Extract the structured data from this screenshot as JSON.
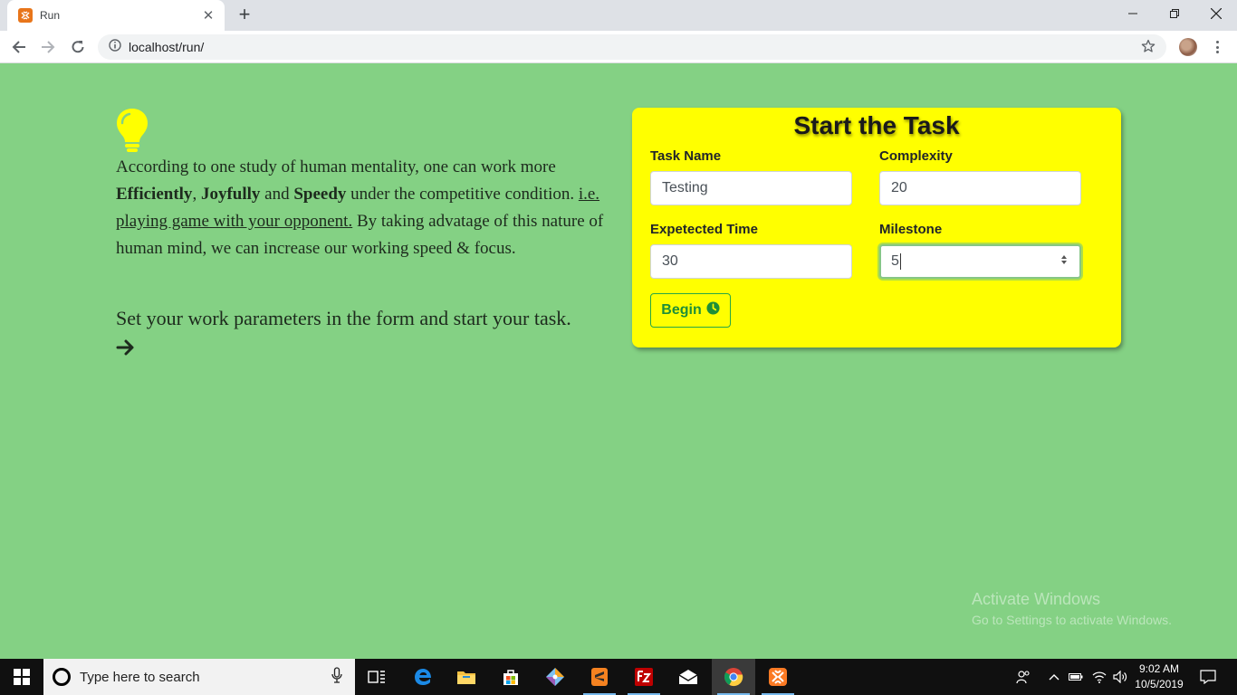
{
  "browser": {
    "tab_title": "Run",
    "url": "localhost/run/"
  },
  "intro": {
    "p1_a": "According to one study of human mentality, one can work more ",
    "p1_b1": "Efficiently",
    "p1_sep1": ", ",
    "p1_b2": "Joyfully",
    "p1_sep2": " and ",
    "p1_b3": "Speedy",
    "p1_c": " under the competitive condition. ",
    "p1_link": "i.e. playing game with your opponent.",
    "p1_d": " By taking advatage of this nature of human mind, we can increase our working speed & focus.",
    "instruction": "Set your work parameters in the form and start your task."
  },
  "form": {
    "title": "Start the Task",
    "task_name_label": "Task Name",
    "task_name_value": "Testing",
    "complexity_label": "Complexity",
    "complexity_value": "20",
    "expected_time_label": "Expetected Time",
    "expected_time_value": "30",
    "milestone_label": "Milestone",
    "milestone_value": "5",
    "begin_label": "Begin"
  },
  "watermark": {
    "line1": "Activate Windows",
    "line2": "Go to Settings to activate Windows."
  },
  "taskbar": {
    "search_placeholder": "Type here to search",
    "time": "9:02 AM",
    "date": "10/5/2019"
  },
  "colors": {
    "page_bg": "#84d184",
    "card_bg": "#ffff00",
    "accent_green": "#28a745",
    "bulb": "#ffff00"
  }
}
